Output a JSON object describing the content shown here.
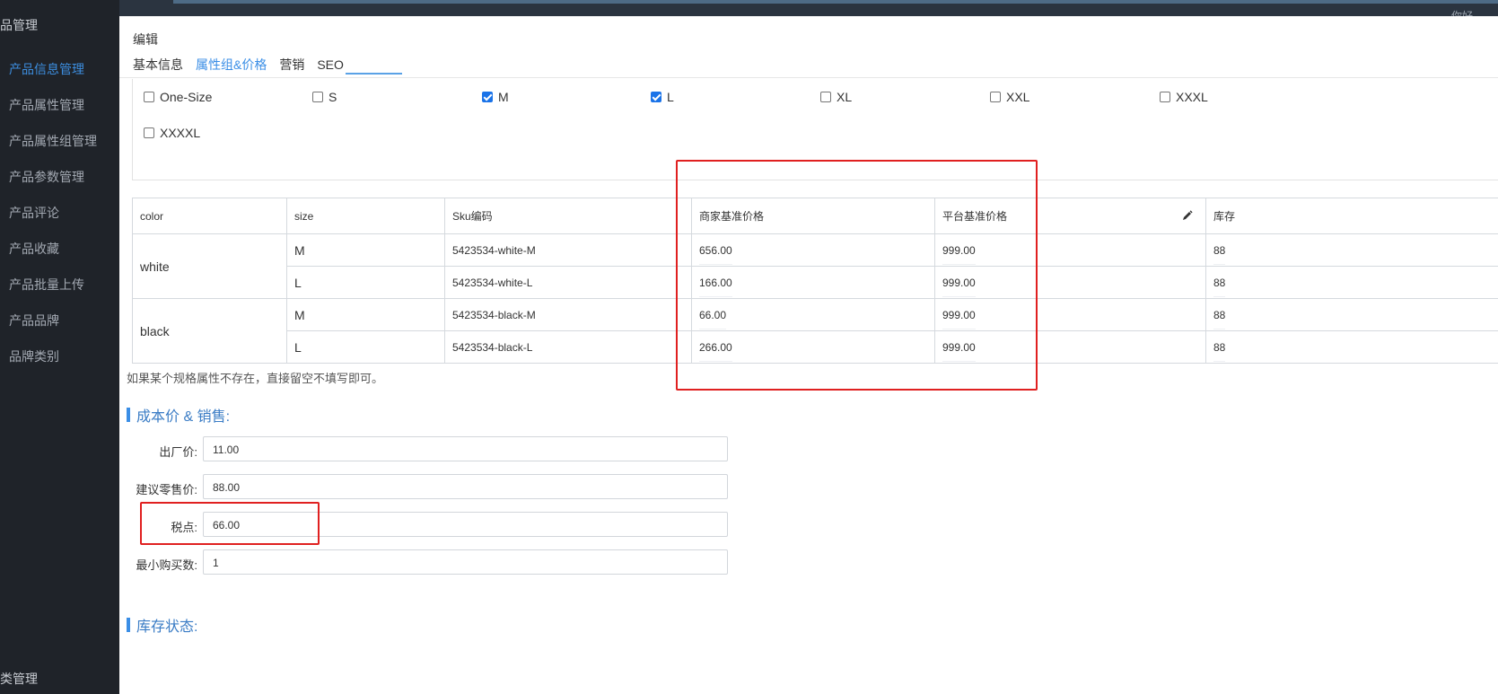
{
  "sidebar": {
    "module_title": "品管理",
    "items": [
      {
        "label": "产品信息管理",
        "active": true
      },
      {
        "label": "产品属性管理",
        "active": false
      },
      {
        "label": "产品属性组管理",
        "active": false
      },
      {
        "label": "产品参数管理",
        "active": false
      },
      {
        "label": "产品评论",
        "active": false
      },
      {
        "label": "产品收藏",
        "active": false
      },
      {
        "label": "产品批量上传",
        "active": false
      },
      {
        "label": "产品品牌",
        "active": false
      },
      {
        "label": "品牌类别",
        "active": false
      }
    ],
    "bottom_module": "类管理"
  },
  "topbar": {
    "right_text": "你好，"
  },
  "modal": {
    "title": "编辑",
    "tabs": [
      {
        "label": "基本信息",
        "active": false
      },
      {
        "label": "属性组&价格",
        "active": true
      },
      {
        "label": "营销",
        "active": false
      },
      {
        "label": "SEO",
        "active": false
      }
    ]
  },
  "sizes": [
    {
      "label": "One-Size",
      "checked": false
    },
    {
      "label": "S",
      "checked": false
    },
    {
      "label": "M",
      "checked": true
    },
    {
      "label": "L",
      "checked": true
    },
    {
      "label": "XL",
      "checked": false
    },
    {
      "label": "XXL",
      "checked": false
    },
    {
      "label": "XXXL",
      "checked": false
    },
    {
      "label": "XXXXL",
      "checked": false
    }
  ],
  "sku_table": {
    "headers": {
      "color": "color",
      "size": "size",
      "sku": "Sku编码",
      "merchant_price": "商家基准价格",
      "platform_price": "平台基准价格",
      "stock": "库存"
    },
    "groups": [
      {
        "color": "white",
        "rows": [
          {
            "size": "M",
            "sku": "5423534-white-M",
            "merchant_price": "656.00",
            "platform_price": "999.00",
            "stock": "88"
          },
          {
            "size": "L",
            "sku": "5423534-white-L",
            "merchant_price": "166.00",
            "platform_price": "999.00",
            "stock": "88"
          }
        ]
      },
      {
        "color": "black",
        "rows": [
          {
            "size": "M",
            "sku": "5423534-black-M",
            "merchant_price": "66.00",
            "platform_price": "999.00",
            "stock": "88"
          },
          {
            "size": "L",
            "sku": "5423534-black-L",
            "merchant_price": "266.00",
            "platform_price": "999.00",
            "stock": "88"
          }
        ]
      }
    ]
  },
  "hint": "如果某个规格属性不存在，直接留空不填写即可。",
  "cost_section": {
    "title": "成本价 & 销售:",
    "fields": {
      "factory_price": {
        "label": "出厂价:",
        "value": "11.00"
      },
      "retail_price": {
        "label": "建议零售价:",
        "value": "88.00"
      },
      "tax": {
        "label": "税点:",
        "value": "66.00"
      },
      "min_qty": {
        "label": "最小购买数:",
        "value": "1"
      }
    }
  },
  "stock_section": {
    "title": "库存状态:"
  },
  "colors": {
    "annotation": "#e02020",
    "accent": "#3a8ee6",
    "sidebar_bg": "#1f2329"
  }
}
